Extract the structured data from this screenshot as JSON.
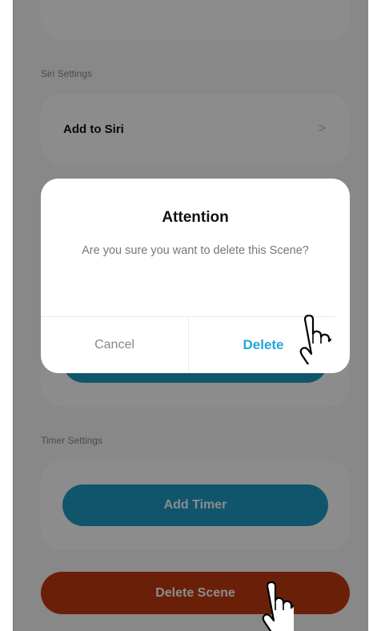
{
  "siri_section": {
    "label": "Siri Settings",
    "add_to_siri": "Add to Siri",
    "chevron": ">"
  },
  "timer_section": {
    "label": "Timer Settings",
    "add_timer": "Add Timer"
  },
  "delete_scene": "Delete Scene",
  "dialog": {
    "title": "Attention",
    "message": "Are you sure you want to delete this Scene?",
    "cancel": "Cancel",
    "confirm": "Delete"
  },
  "colors": {
    "accent_blue": "#1f9cc5",
    "delete_red": "#c23b10",
    "delete_text": "#1fa7d8"
  },
  "icons": [
    "hand-pointer-icon",
    "chevron-right-icon"
  ]
}
